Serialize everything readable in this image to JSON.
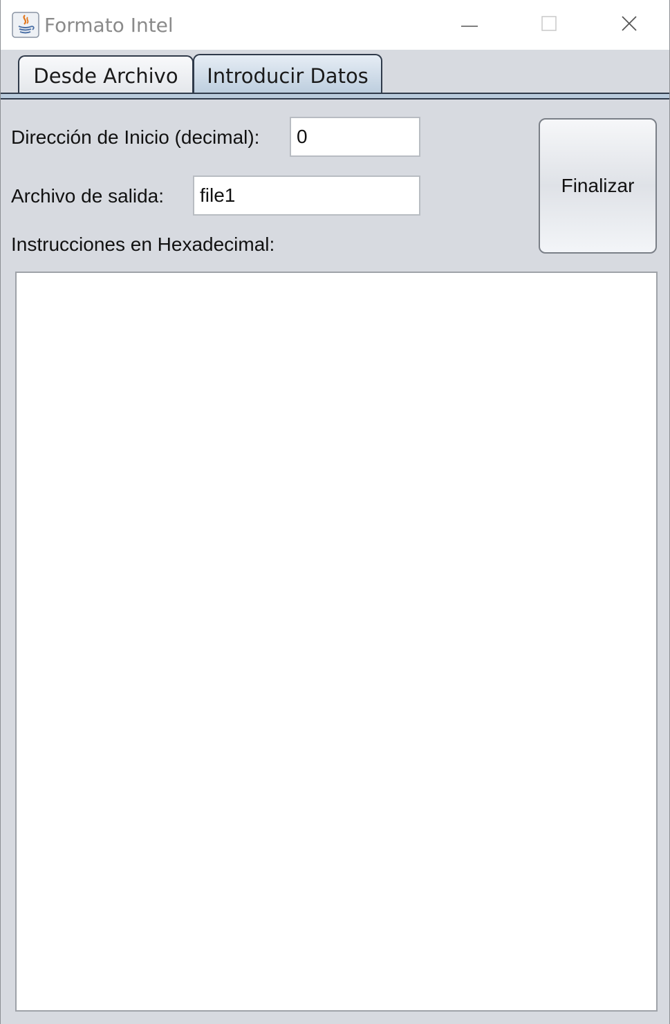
{
  "window": {
    "title": "Formato Intel"
  },
  "tabs": [
    {
      "label": "Desde Archivo",
      "selected": false
    },
    {
      "label": "Introducir Datos",
      "selected": true
    }
  ],
  "form": {
    "start_address_label": "Dirección de Inicio (decimal):",
    "start_address_value": "0",
    "output_file_label": "Archivo de salida:",
    "output_file_value": "file1",
    "hex_instructions_label": "Instrucciones en Hexadecimal:",
    "hex_instructions_value": "",
    "finish_label": "Finalizar"
  },
  "icons": {
    "app": "java-coffee-icon",
    "minimize": "minimize-icon",
    "maximize": "maximize-icon",
    "close": "close-icon"
  },
  "colors": {
    "window_bg": "#d7dae0",
    "selected_tab": "#b9cbdc",
    "tab_border": "#2f3a4a"
  }
}
